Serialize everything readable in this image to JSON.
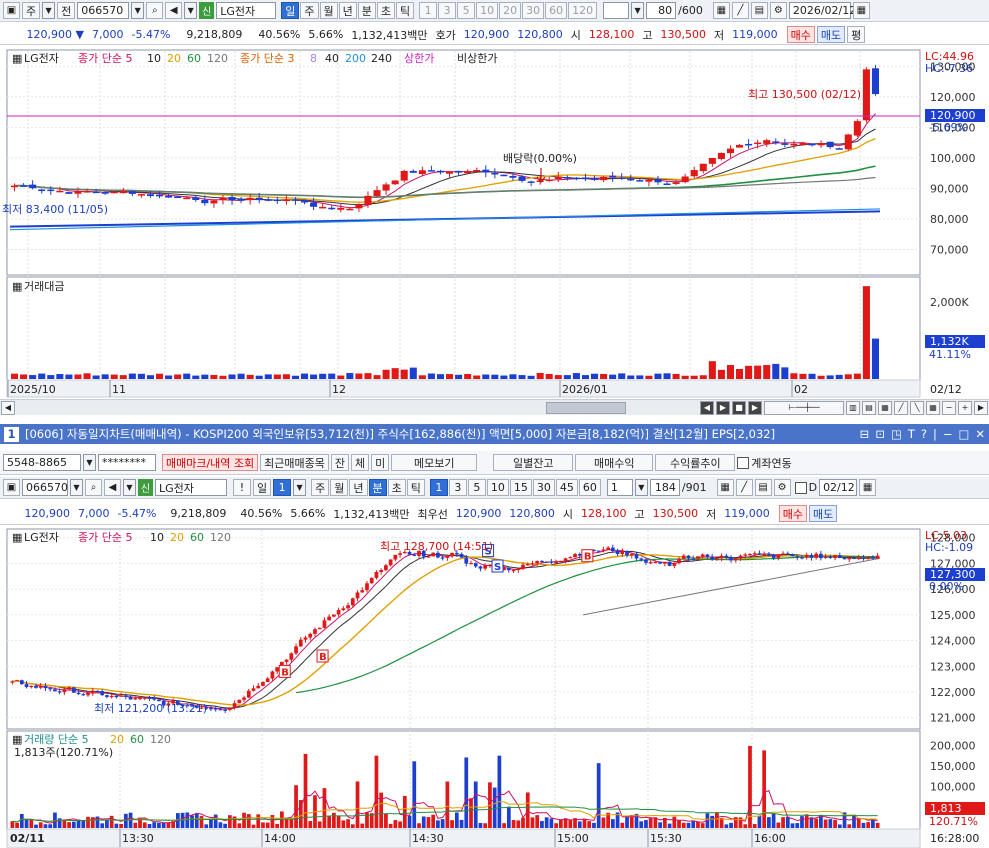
{
  "top": {
    "toolbar": {
      "type_label": "주",
      "prefix_label": "전",
      "code": "066570",
      "shin": "신",
      "name": "LG전자",
      "periods": [
        "일",
        "주",
        "월",
        "년",
        "분",
        "초",
        "틱"
      ],
      "period_selected": 0,
      "nums": [
        "1",
        "3",
        "5",
        "10",
        "20",
        "30",
        "60",
        "120"
      ],
      "count": "80",
      "total": "/600",
      "date": "2026/02/12"
    },
    "quote": {
      "price": "120,900",
      "change": "7,000",
      "rate": "-5.47%",
      "volume": "9,218,809",
      "ratio1": "40.56%",
      "ratio2": "5.66%",
      "amount": "1,132,413백만",
      "hoga_label": "호가",
      "ask": "120,900",
      "bid": "120,800",
      "open_label": "시",
      "open": "128,100",
      "high_label": "고",
      "high": "130,500",
      "low_label": "저",
      "low": "119,000",
      "buy": "매수",
      "sell": "매도",
      "eval": "평"
    },
    "legend": {
      "name": "LG전자",
      "ma_a": "종가 단순 5",
      "ma_b": [
        "10",
        "20",
        "60",
        "120"
      ],
      "ma_c": "종가 단순 3",
      "ma_d": [
        "8",
        "40",
        "200",
        "240"
      ],
      "upper": "상한가",
      "lower": "비상한가"
    },
    "price_axis": [
      "130,000",
      "120,000",
      "110,000",
      "100,000",
      "90,000",
      "80,000",
      "70,000"
    ],
    "lc": "LC:44.96",
    "hc": "HC:-7.36",
    "current_tag": "120,900",
    "current_rate": "-5.69%",
    "annot_high": "최고 130,500 (02/12)",
    "annot_low": "최저 83,400 (11/05)",
    "annot_div": "배당락(0.00%)",
    "vol_title": "거래대금",
    "vol_axis": [
      "2,000K",
      "1,000K"
    ],
    "vol_tag": "1,132K",
    "vol_rate": "41.11%",
    "xaxis": [
      "2025/10",
      "11",
      "12",
      "2026/01",
      "02"
    ],
    "xaxis_right": "02/12"
  },
  "window": {
    "badge": "1",
    "title": "[0606] 자동일지차트(매매내역) - KOSPI200 외국인보유[53,712(천)] 주식수[162,886(천)] 액면[5,000] 자본금[8,182(억)] 결산[12월] EPS[2,032]"
  },
  "bottom": {
    "account": {
      "number": "5548-8865",
      "password": "********",
      "btn1": "매매마크/내역 조회",
      "btn2": "최근매매종목",
      "chk_labels": [
        "잔",
        "체",
        "미"
      ],
      "memo": "메모보기",
      "daily": "일별잔고",
      "profit": "매매수익",
      "trend": "수익률추이",
      "link": "계좌연동"
    },
    "toolbar": {
      "code": "066570",
      "shin": "신",
      "name": "LG전자",
      "excl": "!",
      "periods": [
        "일",
        "주",
        "월",
        "년",
        "분",
        "초",
        "틱"
      ],
      "period_selected": 4,
      "num_first": "1",
      "nums": [
        "1",
        "3",
        "5",
        "10",
        "15",
        "30",
        "45",
        "60"
      ],
      "unit": "1",
      "count": "184",
      "total": "/901",
      "d_label": "D",
      "date": "02/12"
    },
    "quote": {
      "price": "120,900",
      "change": "7,000",
      "rate": "-5.47%",
      "volume": "9,218,809",
      "ratio1": "40.56%",
      "ratio2": "5.66%",
      "amount": "1,132,413백만",
      "best_label": "최우선",
      "ask": "120,900",
      "bid": "120,800",
      "open_label": "시",
      "open": "128,100",
      "high_label": "고",
      "high": "130,500",
      "low_label": "저",
      "low": "119,000",
      "buy": "매수",
      "sell": "매도"
    },
    "legend": {
      "name": "LG전자",
      "ma": "종가 단순 5",
      "ma_b": [
        "10",
        "20",
        "60",
        "120"
      ]
    },
    "price_axis": [
      "128,000",
      "127,000",
      "126,000",
      "125,000",
      "124,000",
      "123,000",
      "122,000",
      "121,000"
    ],
    "lc": "LC:5.03",
    "hc": "HC:-1.09",
    "current_tag": "127,300",
    "current_rate": "0.00%",
    "annot_high": "최고 128,700 (14:51)",
    "annot_low": "최저 121,200 (13:21)",
    "vol_legend": "거래량 단순 5",
    "vol_ma": [
      "20",
      "60",
      "120"
    ],
    "vol_sub": "1,813주(120.71%)",
    "vol_axis": [
      "200,000",
      "150,000",
      "100,000",
      "50,000"
    ],
    "vol_tag": "1,813",
    "vol_rate": "120.71%",
    "xaxis_first": "02/11",
    "xaxis": [
      "13:30",
      "14:00",
      "14:30",
      "15:00",
      "15:30",
      "16:00"
    ],
    "xaxis_right": "16:28:00"
  },
  "colors": {
    "up": "#e01818",
    "down": "#1c3fd0",
    "ma5": "#d01060",
    "ma20": "#e0a000",
    "ma60": "#209040",
    "ma120": "#777777",
    "hline": "#d020c0"
  }
}
